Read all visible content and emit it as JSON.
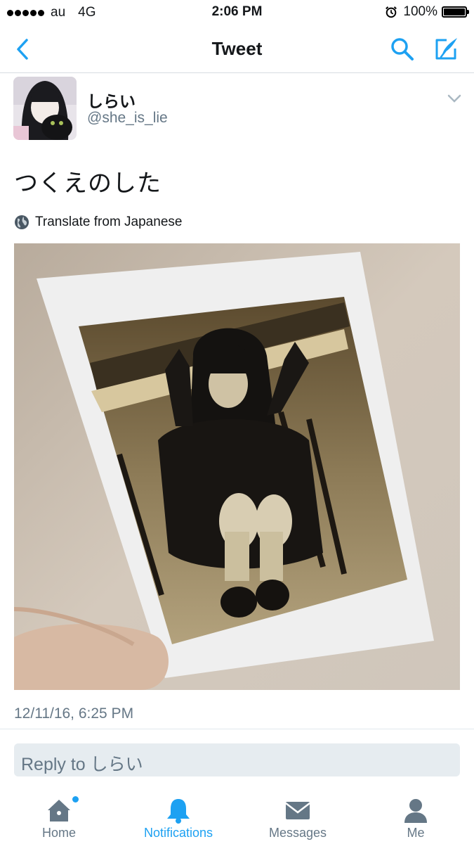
{
  "status_bar": {
    "carrier": "au",
    "network": "4G",
    "time": "2:06 PM",
    "battery": "100%"
  },
  "nav": {
    "title": "Tweet",
    "back_icon": "chevron-left-icon",
    "search_icon": "search-icon",
    "compose_icon": "compose-icon"
  },
  "tweet": {
    "display_name": "しらい",
    "handle": "@she_is_lie",
    "text": "つくえのした",
    "translate_label": "Translate from Japanese",
    "timestamp": "12/11/16, 6:25 PM"
  },
  "reply": {
    "placeholder": "Reply to しらい"
  },
  "tabs": [
    {
      "label": "Home",
      "icon": "home-icon",
      "active": false,
      "unread": true
    },
    {
      "label": "Notifications",
      "icon": "bell-icon",
      "active": true,
      "unread": false
    },
    {
      "label": "Messages",
      "icon": "envelope-icon",
      "active": false,
      "unread": false
    },
    {
      "label": "Me",
      "icon": "person-icon",
      "active": false,
      "unread": false
    }
  ],
  "colors": {
    "accent": "#1da1f2",
    "secondary_text": "#657786",
    "reply_box": "#e6ecf0"
  }
}
